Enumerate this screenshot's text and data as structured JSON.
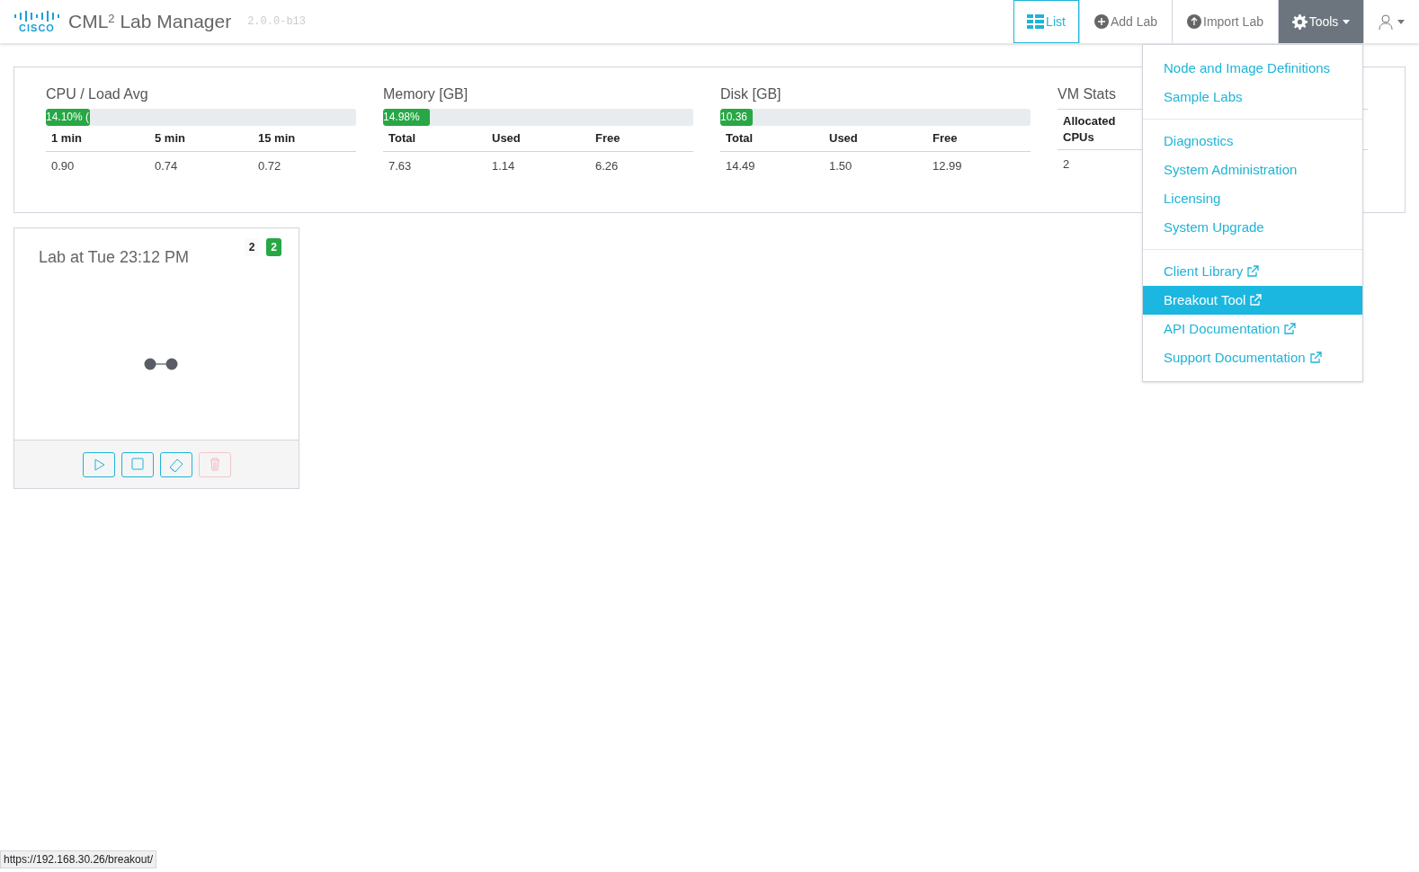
{
  "header": {
    "logo": "CISCO",
    "title": "CML",
    "title_sup": "2",
    "title_rest": "Lab Manager",
    "version": "2.0.0-b13"
  },
  "nav": [
    {
      "kind": "list",
      "label": "List",
      "selected": true,
      "expanded": false
    },
    {
      "kind": "add",
      "label": "Add Lab",
      "selected": false,
      "expanded": false
    },
    {
      "kind": "import",
      "label": "Import Lab",
      "selected": false,
      "expanded": false
    },
    {
      "kind": "tools",
      "label": "Tools",
      "selected": false,
      "expanded": true
    },
    {
      "kind": "user",
      "selected": false,
      "expanded": false
    }
  ],
  "stats": [
    {
      "title": "CPU / Load Avg",
      "bar": {
        "label": "14.10% (",
        "level": 0.142
      },
      "columns": [
        "1 min",
        "5 min",
        "15 min"
      ],
      "values": [
        "0.90",
        "0.74",
        "0.72"
      ]
    },
    {
      "title": "Memory [GB]",
      "bar": {
        "label": "14.98%",
        "level": 0.1498
      },
      "columns": [
        "Total",
        "Used",
        "Free"
      ],
      "values": [
        "7.63",
        "1.14",
        "6.26"
      ]
    },
    {
      "title": "Disk [GB]",
      "bar": {
        "label": "10.36",
        "level": 0.1036
      },
      "columns": [
        "Total",
        "Used",
        "Free"
      ],
      "values": [
        "14.49",
        "1.50",
        "12.99"
      ]
    },
    {
      "title": "VM Stats",
      "columns": [
        "Allocated CPUs"
      ],
      "values": [
        "2"
      ]
    }
  ],
  "labs": [
    {
      "title": "Lab at Tue 23:12 PM",
      "badges": [
        {
          "kind": "plain",
          "text": "2"
        },
        {
          "kind": "success",
          "text": "2"
        }
      ],
      "actions": [
        {
          "kind": "start",
          "disabled": false
        },
        {
          "kind": "stop",
          "disabled": false
        },
        {
          "kind": "wipe",
          "disabled": false
        },
        {
          "kind": "delete",
          "disabled": true
        }
      ]
    }
  ],
  "tools_menu": [
    [
      {
        "label": "Node and Image Definitions",
        "external": false,
        "selected": false
      },
      {
        "label": "Sample Labs",
        "external": false,
        "selected": false
      }
    ],
    [
      {
        "label": "Diagnostics",
        "external": false,
        "selected": false
      },
      {
        "label": "System Administration",
        "external": false,
        "selected": false
      },
      {
        "label": "Licensing",
        "external": false,
        "selected": false
      },
      {
        "label": "System Upgrade",
        "external": false,
        "selected": false
      }
    ],
    [
      {
        "label": "Client Library",
        "external": true,
        "selected": false
      },
      {
        "label": "Breakout Tool",
        "external": true,
        "selected": true
      },
      {
        "label": "API Documentation",
        "external": true,
        "selected": false
      },
      {
        "label": "Support Documentation",
        "external": true,
        "selected": false
      }
    ]
  ],
  "status_bar": {
    "url": "https://192.168.30.26/breakout/"
  }
}
